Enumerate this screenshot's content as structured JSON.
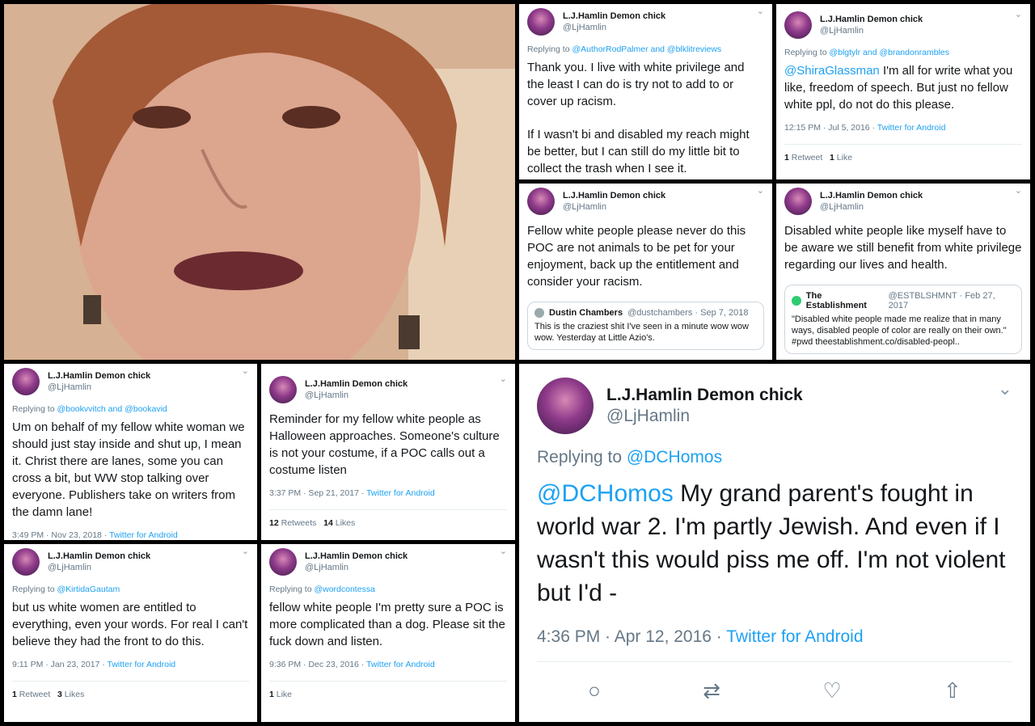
{
  "photo": {
    "alt": ""
  },
  "author": {
    "name": "L.J.Hamlin Demon chick",
    "handle": "@LjHamlin"
  },
  "tweets": [
    {
      "replying": "Replying to ",
      "replying_to": "@AuthorRodPalmer and @blklitreviews",
      "text": "Thank you. I live with white privilege and the least I can do is try not to add to or cover up racism.",
      "text2": "If I wasn't bi and disabled my reach might be better, but I can still do my little bit to collect the trash when I see it."
    },
    {
      "replying": "Replying to ",
      "replying_to": "@blgtylr and @brandonrambles",
      "mention": "@ShiraGlassman",
      "text": " I'm all for write what you like, freedom of speech. But just no fellow white ppl, do not do this please.",
      "time": "12:15 PM · Jul 5, 2016 · ",
      "source": "Twitter for Android",
      "retweets": "1",
      "retweets_label": " Retweet",
      "likes": "1",
      "likes_label": " Like"
    },
    {
      "text": "Fellow white people please never do this POC are not animals to be pet for your enjoyment, back up the entitlement and consider your racism.",
      "quote": {
        "name": "Dustin Chambers",
        "meta": "@dustchambers · Sep 7, 2018",
        "text": "This is the craziest shit I've seen in a minute wow wow wow. Yesterday at Little Azio's."
      }
    },
    {
      "text": "Disabled white people like myself have to be aware we still benefit from white privilege regarding our lives and health.",
      "quote": {
        "name": "The Establishment",
        "meta": "@ESTBLSHMNT · Feb 27, 2017",
        "text": "\"Disabled white people made me realize that in many ways, disabled people of color are really on their own.\" #pwd theestablishment.co/disabled-peopl.."
      }
    },
    {
      "replying": "Replying to ",
      "replying_to": "@bookvvitch and @bookavid",
      "text": "Um on behalf of my fellow white woman we should just stay inside and shut up, I mean it. Christ there are lanes, some you can cross a bit, but WW stop talking over everyone. Publishers take on writers from the damn lane!",
      "time": "3:49 PM · Nov 23, 2018 · ",
      "source": "Twitter for Android"
    },
    {
      "text": "Reminder for my fellow white people as Halloween approaches. Someone's culture is not your costume, if a POC calls out a costume listen",
      "time": "3:37 PM · Sep 21, 2017 · ",
      "source": "Twitter for Android",
      "retweets": "12",
      "retweets_label": " Retweets",
      "likes": "14",
      "likes_label": " Likes"
    },
    {
      "replying": "Replying to ",
      "replying_to": "@KirtidaGautam",
      "text": "but us white women are entitled to everything, even your words. For real I can't believe they had the front to do this.",
      "time": "9:11 PM · Jan 23, 2017 · ",
      "source": "Twitter for Android",
      "retweets": "1",
      "retweets_label": " Retweet",
      "likes": "3",
      "likes_label": " Likes"
    },
    {
      "replying": "Replying to ",
      "replying_to": "@wordcontessa",
      "text": "fellow white people I'm pretty sure a POC is more complicated than a dog. Please sit the fuck down and listen.",
      "time": "9:36 PM · Dec 23, 2016 · ",
      "source": "Twitter for Android",
      "likes": "1",
      "likes_label": " Like"
    },
    {
      "replying": "Replying to ",
      "replying_to": "@DCHomos",
      "mention": "@DCHomos",
      "text": " My grand parent's fought in world war 2. I'm partly Jewish. And even if I wasn't this would piss me off. I'm not violent but I'd -",
      "time": "4:36 PM · Apr 12, 2016 · ",
      "source": "Twitter for Android"
    }
  ],
  "icons": {
    "chevron": "chevron-down-icon",
    "reply": "reply-icon",
    "retweet": "retweet-icon",
    "like": "heart-icon",
    "share": "share-icon"
  },
  "colors": {
    "link": "#1da1f2",
    "muted": "#657786",
    "text": "#14171a",
    "bg": "#000000"
  }
}
